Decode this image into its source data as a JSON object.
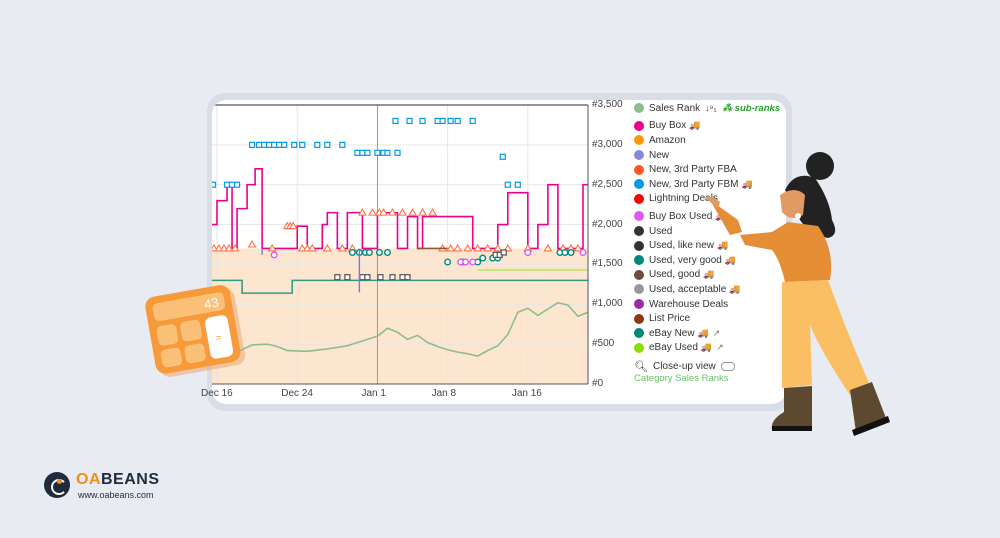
{
  "brand": {
    "name_prefix": "OA",
    "name_suffix": "BEANS",
    "url": "www.oabeans.com"
  },
  "calculator": {
    "display": "43",
    "equals": "="
  },
  "legend": {
    "sales_rank": "Sales Rank",
    "sort_icon": "↓⁹₁",
    "sub_ranks": "sub-ranks",
    "items": [
      {
        "label": "Buy Box",
        "color": "#ec008c",
        "truck": true,
        "ext": false,
        "gap_before": true
      },
      {
        "label": "Amazon",
        "color": "#ff9900",
        "truck": false,
        "ext": false
      },
      {
        "label": "New",
        "color": "#8888dd",
        "truck": false,
        "ext": false
      },
      {
        "label": "New, 3rd Party FBA",
        "color": "#ff5722",
        "truck": false,
        "ext": false
      },
      {
        "label": "New, 3rd Party FBM",
        "color": "#039be5",
        "truck": true,
        "ext": false
      },
      {
        "label": "Lightning Deals",
        "color": "#ff0000",
        "truck": false,
        "ext": false
      },
      {
        "label": "Buy Box Used",
        "color": "#da5cf0",
        "truck": true,
        "ext": false,
        "gap_before": true
      },
      {
        "label": "Used",
        "color": "#333333",
        "truck": false,
        "ext": false
      },
      {
        "label": "Used, like new",
        "color": "#333333",
        "truck": true,
        "ext": false
      },
      {
        "label": "Used, very good",
        "color": "#00897b",
        "truck": true,
        "ext": false
      },
      {
        "label": "Used, good",
        "color": "#6d4c41",
        "truck": true,
        "ext": false
      },
      {
        "label": "Used, acceptable",
        "color": "#999999",
        "truck": true,
        "ext": false
      },
      {
        "label": "Warehouse Deals",
        "color": "#9c27b0",
        "truck": false,
        "ext": false
      },
      {
        "label": "List Price",
        "color": "#8b3a0e",
        "truck": false,
        "ext": false
      },
      {
        "label": "eBay New",
        "color": "#00897b",
        "truck": true,
        "ext": true
      },
      {
        "label": "eBay Used",
        "color": "#8bdd00",
        "truck": true,
        "ext": true
      }
    ],
    "sales_rank_color": "#8fbc8f",
    "truck_icon": "🚚",
    "ext_icon": "↗",
    "closeup_label": "Close-up view",
    "category_link": "Category Sales Ranks"
  },
  "chart_data": {
    "type": "line",
    "title": "",
    "xlabel": "",
    "ylabel": "Sales Rank",
    "x_ticks": [
      "Dec 16",
      "Dec 24",
      "Jan 1",
      "Jan 8",
      "Jan 16"
    ],
    "y_ticks": [
      "#0",
      "#500",
      "#1,000",
      "#1,500",
      "#2,000",
      "#2,500",
      "#3,000",
      "#3,500"
    ],
    "ylim": [
      0,
      3500
    ],
    "x_range_days": [
      -16.5,
      21
    ],
    "legend_position": "right",
    "grid": true,
    "series": [
      {
        "name": "Sales Rank",
        "color": "#8fbc8f",
        "points": [
          [
            -16.5,
            370
          ],
          [
            -14,
            400
          ],
          [
            -12.5,
            490
          ],
          [
            -11,
            500
          ],
          [
            -10,
            470
          ],
          [
            -9,
            420
          ],
          [
            -7,
            410
          ],
          [
            -5,
            440
          ],
          [
            -3,
            480
          ],
          [
            -1,
            560
          ],
          [
            0,
            600
          ],
          [
            1,
            700
          ],
          [
            2,
            650
          ],
          [
            3,
            560
          ],
          [
            4,
            610
          ],
          [
            5,
            520
          ],
          [
            6,
            470
          ],
          [
            7,
            430
          ],
          [
            8,
            400
          ],
          [
            9,
            380
          ],
          [
            10,
            350
          ],
          [
            11,
            420
          ],
          [
            12,
            480
          ],
          [
            13,
            620
          ],
          [
            14,
            900
          ],
          [
            15,
            950
          ],
          [
            16,
            860
          ],
          [
            17,
            940
          ],
          [
            18,
            1020
          ],
          [
            19,
            990
          ],
          [
            20,
            850
          ],
          [
            21,
            900
          ]
        ]
      },
      {
        "name": "Buy Box",
        "color": "#ec008c",
        "steps": [
          [
            -16.5,
            2000
          ],
          [
            -16,
            2300
          ],
          [
            -15,
            2500
          ],
          [
            -14.5,
            1700
          ],
          [
            -14,
            2200
          ],
          [
            -13,
            2500
          ],
          [
            -12.2,
            2700
          ],
          [
            -11.5,
            1700
          ],
          [
            -8,
            1980
          ],
          [
            -7,
            1700
          ],
          [
            -5.5,
            2000
          ],
          [
            -5,
            2150
          ],
          [
            -4,
            1700
          ],
          [
            -3,
            2150
          ],
          [
            -1.5,
            1700
          ],
          [
            0,
            2150
          ],
          [
            1,
            2150
          ],
          [
            2,
            1700
          ],
          [
            3,
            2100
          ],
          [
            4,
            1700
          ],
          [
            4.5,
            2100
          ],
          [
            5,
            2100
          ],
          [
            9,
            2100
          ],
          [
            9.5,
            1700
          ],
          [
            12,
            2000
          ],
          [
            13,
            2400
          ],
          [
            14,
            2400
          ],
          [
            15,
            1700
          ],
          [
            16,
            2000
          ],
          [
            17,
            2500
          ],
          [
            18,
            1700
          ],
          [
            20.5,
            2500
          ],
          [
            21,
            2500
          ]
        ]
      },
      {
        "name": "eBay New",
        "color": "#2e9e83",
        "steps": [
          [
            -16.5,
            1300
          ],
          [
            -13.5,
            1300
          ],
          [
            -13.5,
            1140
          ],
          [
            -8.5,
            1140
          ],
          [
            -8.5,
            1300
          ],
          [
            21,
            1300
          ]
        ]
      },
      {
        "name": "eBay Used",
        "color": "#b9e35a",
        "steps": [
          [
            10,
            1430
          ],
          [
            21,
            1430
          ]
        ]
      },
      {
        "name": "New, 3rd Party FBM",
        "color": "#039be5",
        "marker": "square",
        "points": [
          [
            -16.4,
            2500
          ],
          [
            -15,
            2500
          ],
          [
            -14.5,
            2500
          ],
          [
            -14,
            2500
          ],
          [
            -12.5,
            3000
          ],
          [
            -11.8,
            3000
          ],
          [
            -11.3,
            3000
          ],
          [
            -10.8,
            3000
          ],
          [
            -10.3,
            3000
          ],
          [
            -9.8,
            3000
          ],
          [
            -9.3,
            3000
          ],
          [
            -8.3,
            3000
          ],
          [
            -7.5,
            3000
          ],
          [
            -6,
            3000
          ],
          [
            -5,
            3000
          ],
          [
            -3.5,
            3000
          ],
          [
            -2,
            2900
          ],
          [
            -1.5,
            2900
          ],
          [
            0,
            2900
          ],
          [
            0.6,
            2900
          ],
          [
            1,
            2900
          ],
          [
            2,
            2900
          ],
          [
            -1,
            2900
          ],
          [
            1.8,
            3300
          ],
          [
            3.2,
            3300
          ],
          [
            4.5,
            3300
          ],
          [
            6,
            3300
          ],
          [
            6.5,
            3300
          ],
          [
            7.3,
            3300
          ],
          [
            8,
            3300
          ],
          [
            9.5,
            3300
          ],
          [
            12.5,
            2850
          ],
          [
            13,
            2500
          ],
          [
            14,
            2500
          ]
        ]
      },
      {
        "name": "New, 3rd Party FBA",
        "color": "#ff7043",
        "marker": "triangle",
        "points": [
          [
            -16.3,
            1700
          ],
          [
            -15.8,
            1700
          ],
          [
            -15.3,
            1700
          ],
          [
            -14.8,
            1700
          ],
          [
            -14.2,
            1700
          ],
          [
            -12.5,
            1750
          ],
          [
            -10.5,
            1700
          ],
          [
            -9,
            1980
          ],
          [
            -8.7,
            1980
          ],
          [
            -8.4,
            1980
          ],
          [
            -7.5,
            1700
          ],
          [
            -7,
            1700
          ],
          [
            -6.5,
            1700
          ],
          [
            -5,
            1700
          ],
          [
            -3.5,
            1700
          ],
          [
            -2.5,
            1700
          ],
          [
            -1.5,
            2150
          ],
          [
            -0.5,
            2150
          ],
          [
            0.2,
            2150
          ],
          [
            0.6,
            2150
          ],
          [
            1.5,
            2150
          ],
          [
            2.5,
            2150
          ],
          [
            3.5,
            2150
          ],
          [
            4.5,
            2150
          ],
          [
            5.5,
            2150
          ],
          [
            6.5,
            1700
          ],
          [
            7.3,
            1700
          ],
          [
            8,
            1700
          ],
          [
            9,
            1700
          ],
          [
            10,
            1700
          ],
          [
            11,
            1700
          ],
          [
            12,
            1700
          ],
          [
            13,
            1700
          ],
          [
            15,
            1700
          ],
          [
            17,
            1700
          ],
          [
            18.5,
            1700
          ],
          [
            19.3,
            1700
          ],
          [
            20,
            1700
          ]
        ]
      },
      {
        "name": "Used, very good",
        "color": "#00897b",
        "marker": "circle",
        "points": [
          [
            -2.5,
            1650
          ],
          [
            -1.8,
            1650
          ],
          [
            -1.2,
            1650
          ],
          [
            -0.8,
            1650
          ],
          [
            0.2,
            1650
          ],
          [
            1,
            1650
          ],
          [
            7,
            1530
          ],
          [
            8.5,
            1530
          ],
          [
            10,
            1530
          ],
          [
            10.5,
            1580
          ],
          [
            11.5,
            1580
          ],
          [
            12,
            1580
          ],
          [
            18.2,
            1650
          ],
          [
            18.7,
            1650
          ],
          [
            19.3,
            1650
          ]
        ]
      },
      {
        "name": "Buy Box Used",
        "color": "#da5cf0",
        "marker": "circle",
        "points": [
          [
            -10.3,
            1620
          ],
          [
            8.3,
            1530
          ],
          [
            8.8,
            1530
          ],
          [
            9.5,
            1530
          ],
          [
            15,
            1650
          ],
          [
            20.5,
            1650
          ]
        ]
      },
      {
        "name": "Used",
        "color": "#555555",
        "marker": "square",
        "points": [
          [
            -4,
            1340
          ],
          [
            -3,
            1340
          ],
          [
            -1.5,
            1340
          ],
          [
            -1,
            1340
          ],
          [
            0.3,
            1340
          ],
          [
            1.5,
            1340
          ],
          [
            2.5,
            1340
          ],
          [
            3,
            1340
          ],
          [
            11.8,
            1620
          ],
          [
            12.2,
            1620
          ],
          [
            12.6,
            1650
          ]
        ]
      },
      {
        "name": "New",
        "color": "#7777dd",
        "points": [
          [
            -11.5,
            1620
          ],
          [
            -11.5,
            1700
          ],
          [
            -1.8,
            1150
          ],
          [
            -1.8,
            1700
          ]
        ]
      },
      {
        "name": "List Price",
        "color": "#a0522d",
        "steps": [
          [
            4,
            1700
          ],
          [
            7,
            1700
          ]
        ]
      }
    ]
  }
}
